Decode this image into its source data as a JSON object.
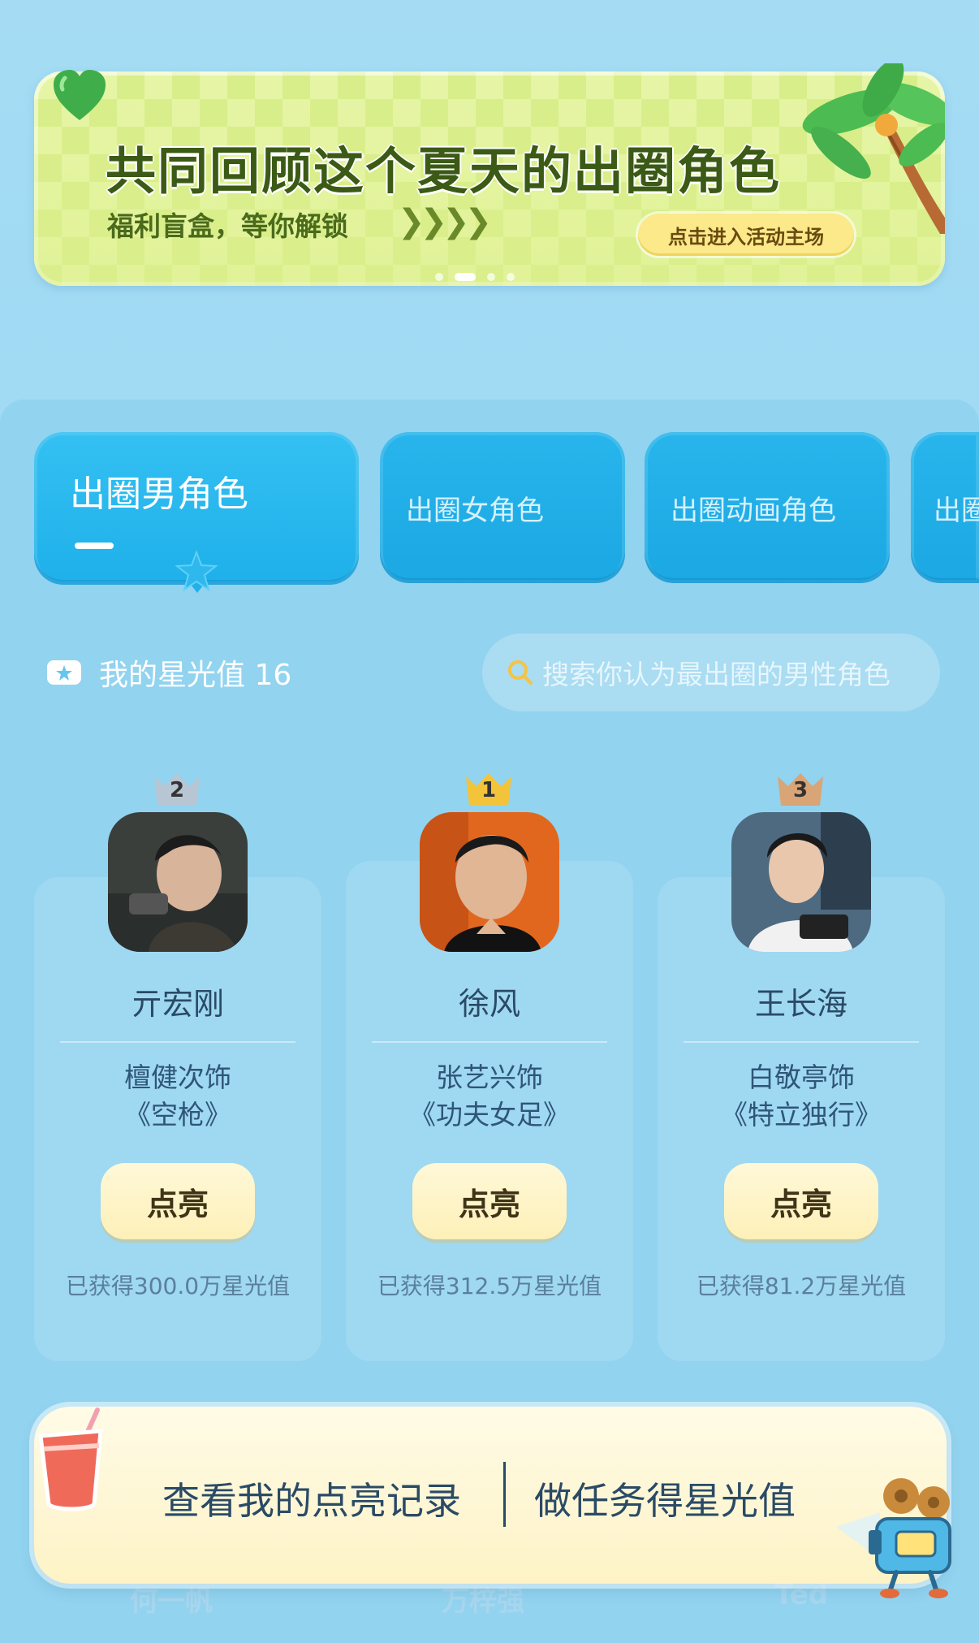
{
  "banner": {
    "title": "共同回顾这个夏天的出圈角色",
    "subtitle": "福利盲盒，等你解锁",
    "arrows": "❯❯❯❯",
    "cta": "点击进入活动主场",
    "page_indicator": {
      "count": 4,
      "active": 2
    }
  },
  "tabs": [
    {
      "label": "出圈男角色",
      "active": true
    },
    {
      "label": "出圈女角色",
      "active": false
    },
    {
      "label": "出圈动画角色",
      "active": false
    },
    {
      "label": "出圈",
      "active": false
    }
  ],
  "star_value": {
    "label": "我的星光值 16"
  },
  "search": {
    "placeholder": "搜索你认为最出圈的男性角色"
  },
  "cards": [
    {
      "rank": "2",
      "name": "亓宏刚",
      "actor": "檀健次饰",
      "work": "《空枪》",
      "button": "点亮",
      "stat": "已获得300.0万星光值",
      "crown_color": "#b8c6d4"
    },
    {
      "rank": "1",
      "name": "徐风",
      "actor": "张艺兴饰",
      "work": "《功夫女足》",
      "button": "点亮",
      "stat": "已获得312.5万星光值",
      "crown_color": "#f3c33a"
    },
    {
      "rank": "3",
      "name": "王长海",
      "actor": "白敬亭饰",
      "work": "《特立独行》",
      "button": "点亮",
      "stat": "已获得81.2万星光值",
      "crown_color": "#d9a577"
    }
  ],
  "bottom_bar": {
    "left": "查看我的点亮记录",
    "right": "做任务得星光值"
  },
  "behind_names": [
    "何一帆",
    "万梓强",
    "Ted"
  ]
}
